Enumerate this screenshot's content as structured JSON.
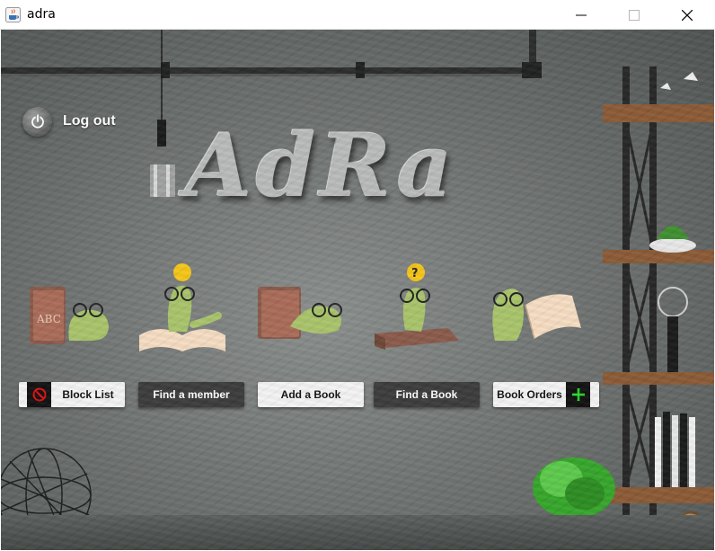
{
  "window": {
    "title": "adra",
    "app_icon": "java-coffee-icon",
    "controls": [
      "minimize-icon",
      "maximize-icon",
      "close-icon"
    ]
  },
  "logout": {
    "label": "Log out",
    "icon": "power-icon"
  },
  "logo": {
    "text": "AdRa"
  },
  "actions": [
    {
      "label": "Block List",
      "icon": "block-icon",
      "style": "light"
    },
    {
      "label": "Find a member",
      "style": "dark"
    },
    {
      "label": "Add a Book",
      "style": "light"
    },
    {
      "label": "Find a Book",
      "style": "dark"
    },
    {
      "label": "Book Orders",
      "icon": "plus-icon",
      "style": "light"
    }
  ],
  "colors": {
    "block_icon": "#e01010",
    "plus_icon": "#29d629",
    "worm_green": "#a8c46a",
    "book_brown": "#8a5a4a",
    "bulb_yellow": "#f5c518"
  }
}
